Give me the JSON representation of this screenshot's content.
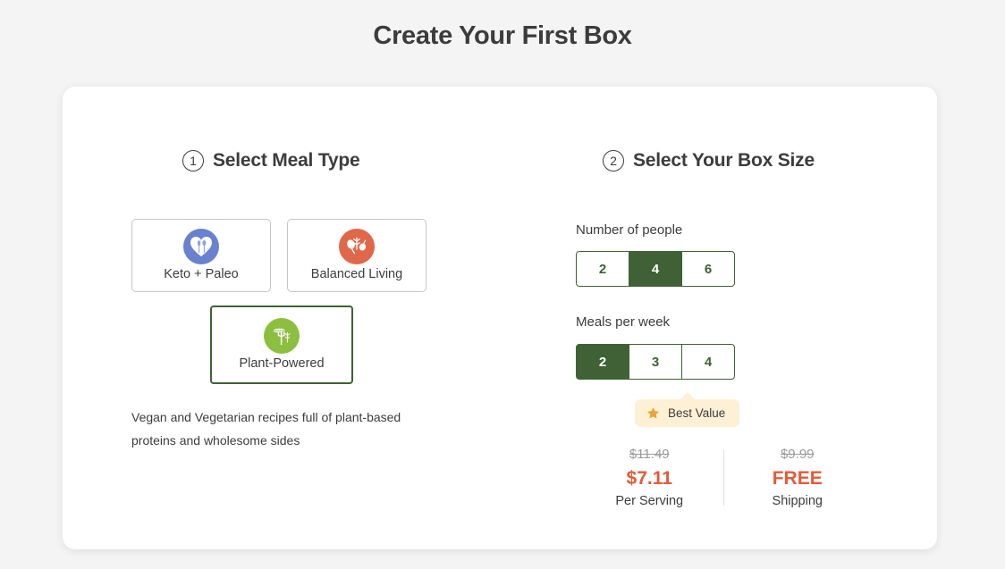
{
  "page": {
    "title": "Create Your First Box",
    "background_color": "#f4f4f4"
  },
  "colors": {
    "brand_green": "#3f6135",
    "plant_green": "#8cbf3f",
    "keto_blue": "#6981cf",
    "balanced_orange": "#e0674a",
    "price_accent": "#e35b38",
    "tooltip_bg": "#fdf0d5",
    "star_gold": "#e8a33d",
    "text_dark": "#3c3c3c"
  },
  "meal_type_section": {
    "step_number": "1",
    "title": "Select Meal Type",
    "options": [
      {
        "label": "Keto + Paleo",
        "icon": "heart-utensils-icon",
        "selected": false
      },
      {
        "label": "Balanced Living",
        "icon": "vegetables-icon",
        "selected": false
      },
      {
        "label": "Plant-Powered",
        "icon": "leaf-fork-icon",
        "selected": true
      }
    ],
    "description": "Vegan and Vegetarian recipes full of plant-based proteins and wholesome sides"
  },
  "box_size_section": {
    "step_number": "2",
    "title": "Select Your Box Size",
    "people": {
      "label": "Number of people",
      "options": [
        "2",
        "4",
        "6"
      ],
      "selected": "4"
    },
    "meals": {
      "label": "Meals per week",
      "options": [
        "2",
        "3",
        "4"
      ],
      "selected": "2"
    },
    "best_value_badge": {
      "label": "Best Value",
      "icon": "star-icon"
    },
    "pricing": [
      {
        "old_price": "$11.49",
        "new_price": "$7.11",
        "note": "Per Serving"
      },
      {
        "old_price": "$9.99",
        "new_price": "FREE",
        "note": "Shipping"
      }
    ]
  }
}
